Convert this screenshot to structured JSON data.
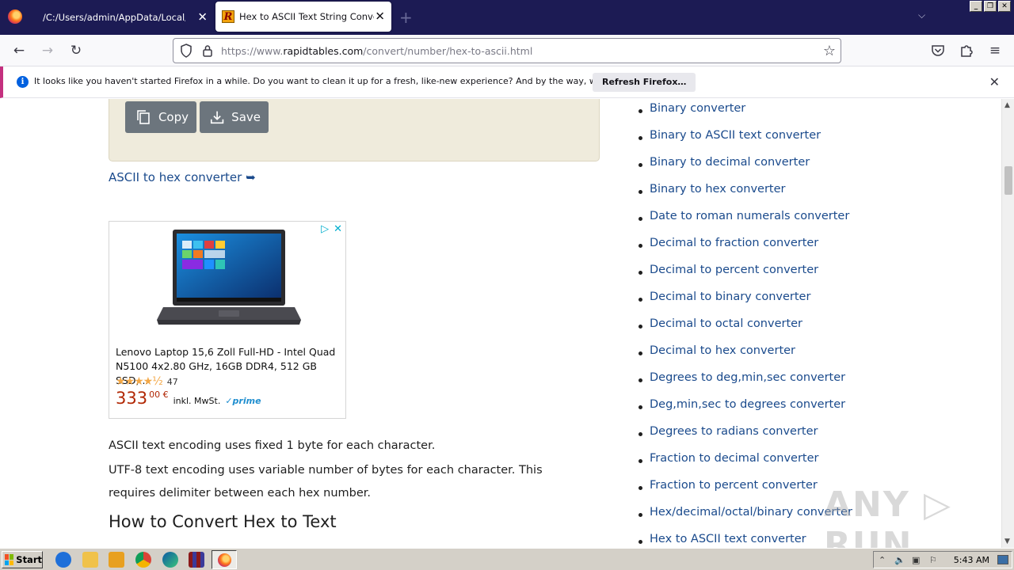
{
  "browser": {
    "tabs": [
      {
        "title": "/C:/Users/admin/AppData/Local/Temp/F",
        "active": false
      },
      {
        "title": "Hex to ASCII Text String Converter",
        "active": true
      }
    ],
    "url_prefix": "https://www.",
    "url_domain": "rapidtables.com",
    "url_path": "/convert/number/hex-to-ascii.html",
    "window_buttons": [
      "_",
      "❐",
      "✕"
    ]
  },
  "notification": {
    "message": "It looks like you haven't started Firefox in a while. Do you want to clean it up for a fresh, like-new experience? And by the way, welcome back!",
    "button_label": "Refresh Firefox…"
  },
  "page": {
    "copy_label": "Copy",
    "save_label": "Save",
    "ascii_link": "ASCII to hex converter ➥",
    "ad": {
      "title": "Lenovo Laptop 15,6 Zoll Full-HD - Intel Quad N5100 4x2.80 GHz, 16GB DDR4, 512 GB SSD,...",
      "stars": "★★★★½",
      "rating_count": "47",
      "rating_value": 4.5,
      "price": "333",
      "price_cents": "00 €",
      "tax_note": "inkl. MwSt.",
      "prime": "✓prime"
    },
    "paragraph1": "ASCII text encoding uses fixed 1 byte for each character.",
    "paragraph2": "UTF-8 text encoding uses variable number of bytes for each character. This requires delimiter between each hex number.",
    "heading": "How to Convert Hex to Text",
    "sidebar_links": [
      "Binary converter",
      "Binary to ASCII text converter",
      "Binary to decimal converter",
      "Binary to hex converter",
      "Date to roman numerals converter",
      "Decimal to fraction converter",
      "Decimal to percent converter",
      "Decimal to binary converter",
      "Decimal to octal converter",
      "Decimal to hex converter",
      "Degrees to deg,min,sec converter",
      "Deg,min,sec to degrees converter",
      "Degrees to radians converter",
      "Fraction to decimal converter",
      "Fraction to percent converter",
      "Hex/decimal/octal/binary converter",
      "Hex to ASCII text converter"
    ]
  },
  "watermark": "ANY ▷ RUN",
  "taskbar": {
    "start_label": "Start",
    "clock": "5:43 AM"
  },
  "colors": {
    "tabstrip": "#1c1b54",
    "link": "#1a4a8c",
    "button_gray": "#6c757d",
    "output_bg": "#efebdc",
    "notif_accent": "#c4307f"
  }
}
